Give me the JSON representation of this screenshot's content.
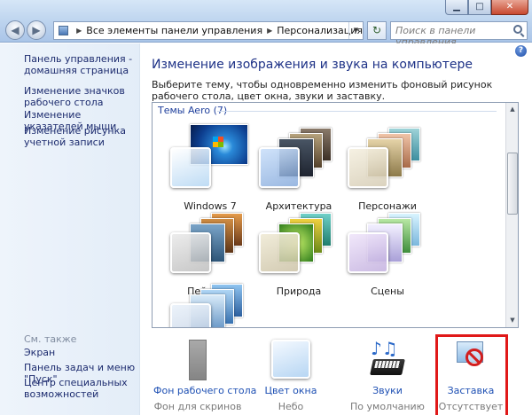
{
  "window": {
    "minimize_glyph": "▁",
    "maximize_glyph": "□",
    "close_glyph": "✕"
  },
  "nav": {
    "back_glyph": "◀",
    "forward_glyph": "▶",
    "breadcrumb": [
      "Все элементы панели управления",
      "Персонализация"
    ],
    "sep_glyph": "▶",
    "dropdown_glyph": "▼",
    "refresh_glyph": "↻",
    "search_placeholder": "Поиск в панели управления"
  },
  "sidebar": {
    "links": [
      "Панель управления - домашняя страница",
      "Изменение значков рабочего стола",
      "Изменение указателей мыши",
      "Изменение рисунка учетной записи"
    ],
    "see_also": "См. также",
    "see_also_links": [
      "Экран",
      "Панель задач и меню \"Пуск\"",
      "Центр специальных возможностей"
    ]
  },
  "main": {
    "help_glyph": "?",
    "heading": "Изменение изображения и звука на компьютере",
    "description": "Выберите тему, чтобы одновременно изменить фоновый рисунок рабочего стола, цвет окна, звуки и заставку.",
    "group_label": "Темы Aero (7)",
    "themes": [
      {
        "name": "Windows 7",
        "icon": "windows7-theme-icon"
      },
      {
        "name": "Архитектура",
        "icon": "architecture-theme-icon"
      },
      {
        "name": "Персонажи",
        "icon": "characters-theme-icon"
      },
      {
        "name": "Пейзажи",
        "icon": "landscapes-theme-icon"
      },
      {
        "name": "Природа",
        "icon": "nature-theme-icon"
      },
      {
        "name": "Сцены",
        "icon": "scenes-theme-icon"
      }
    ],
    "bottom": [
      {
        "title": "Фон рабочего стола",
        "subtitle": "Фон для скринов",
        "icon": "desktop-background-icon"
      },
      {
        "title": "Цвет окна",
        "subtitle": "Небо",
        "icon": "window-color-icon"
      },
      {
        "title": "Звуки",
        "subtitle": "По умолчанию",
        "icon": "sounds-icon"
      },
      {
        "title": "Заставка",
        "subtitle": "Отсутствует",
        "icon": "screensaver-icon"
      }
    ]
  },
  "colors": {
    "link": "#1d4fb3",
    "heading": "#1e3287",
    "highlight": "#e01818"
  }
}
